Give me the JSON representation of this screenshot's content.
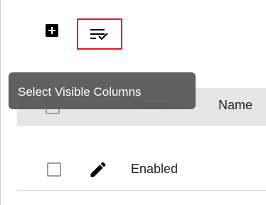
{
  "toolbar": {
    "add_icon": "add-box-icon",
    "columns_icon": "select-columns-icon",
    "highlight_color": "#e8141c"
  },
  "tooltip": {
    "text": "Select Visible Columns"
  },
  "table": {
    "headers": {
      "status": "Status",
      "name": "Name"
    },
    "rows": [
      {
        "status": "Enabled",
        "edit_icon": "pencil-icon"
      }
    ]
  }
}
